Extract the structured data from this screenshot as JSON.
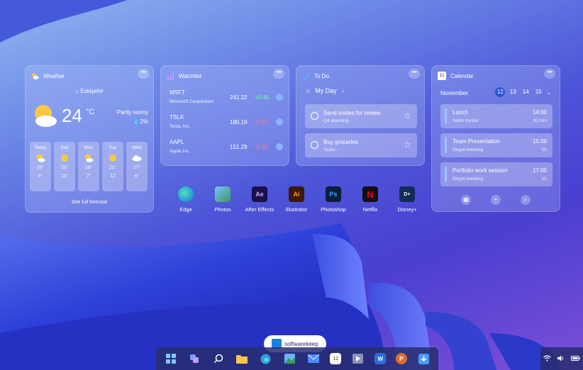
{
  "weather": {
    "title": "Weather",
    "more": "•••",
    "location": "Eskişehir",
    "temp": "24",
    "unit": "°C",
    "condition": "Partly sunny",
    "precip": "2%",
    "days": [
      {
        "name": "Today",
        "hi": "25°",
        "lo": "9°",
        "icon": "partly-sunny"
      },
      {
        "name": "Sun",
        "hi": "22°",
        "lo": "11°",
        "icon": "sunny"
      },
      {
        "name": "Mon",
        "hi": "18°",
        "lo": "7°",
        "icon": "partly-sunny"
      },
      {
        "name": "Tue",
        "hi": "21°",
        "lo": "12",
        "icon": "sunny"
      },
      {
        "name": "Wed",
        "hi": "17°",
        "lo": "6°",
        "icon": "cloudy"
      }
    ],
    "forecast_link": "See full forecast"
  },
  "watchlist": {
    "title": "Watchlist",
    "more": "•••",
    "stocks": [
      {
        "symbol": "MSFT",
        "name": "Microsoft Corporation",
        "price": "241.22",
        "change": "+0.46",
        "direction": "up"
      },
      {
        "symbol": "TSLA",
        "name": "Tesla, Inc.",
        "price": "180.19",
        "change": "-1.63",
        "direction": "down"
      },
      {
        "symbol": "AAPL",
        "name": "Apple Inc.",
        "price": "151.29",
        "change": "-0.38",
        "direction": "down"
      }
    ]
  },
  "todo": {
    "title": "To Do",
    "more": "•••",
    "list_name": "My Day",
    "tasks": [
      {
        "title": "Send invites for review",
        "list": "Q4 planning"
      },
      {
        "title": "Buy groceries",
        "list": "Tasks"
      }
    ]
  },
  "calendar": {
    "title": "Calendar",
    "icon_day": "12",
    "more": "•••",
    "month": "November",
    "days": [
      "12",
      "13",
      "14",
      "15"
    ],
    "selected_day": "12",
    "events": [
      {
        "title": "Lunch",
        "subtitle": "Selim Kestel",
        "time": "14:00",
        "duration": "30 min"
      },
      {
        "title": "Team Presentation",
        "subtitle": "Skype meeting",
        "time": "15:00",
        "duration": "1h"
      },
      {
        "title": "Portfolio work session",
        "subtitle": "Skype meeting",
        "time": "17:00",
        "duration": "1h"
      }
    ]
  },
  "apps": [
    {
      "label": "Edge",
      "icon": "edge-icon",
      "bg": "#0f7ad8",
      "glyph": "e"
    },
    {
      "label": "Photos",
      "icon": "photos-icon",
      "bg": "#3a9a5a",
      "glyph": ""
    },
    {
      "label": "After Effects",
      "icon": "after-effects-icon",
      "bg": "#1a0f4a",
      "glyph": "Ae"
    },
    {
      "label": "Illustrator",
      "icon": "illustrator-icon",
      "bg": "#3a1a08",
      "glyph": "Ai"
    },
    {
      "label": "Photoshop",
      "icon": "photoshop-icon",
      "bg": "#0a1e3a",
      "glyph": "Ps"
    },
    {
      "label": "Netflix",
      "icon": "netflix-icon",
      "bg": "#111111",
      "glyph": "N"
    },
    {
      "label": "Disney+",
      "icon": "disney-plus-icon",
      "bg": "#112c5a",
      "glyph": "D+"
    }
  ],
  "watermark": {
    "text": "softwarekeep"
  },
  "taskbar": {
    "items": [
      {
        "name": "start-icon",
        "glyph": "⊞",
        "color": "#7ec8ff"
      },
      {
        "name": "widgets-icon",
        "glyph": "▣",
        "color": "#9ab0ff"
      },
      {
        "name": "search-icon",
        "glyph": "⌕",
        "color": "#ffffff"
      },
      {
        "name": "file-explorer-icon",
        "glyph": "▬",
        "color": "#f5c84a"
      },
      {
        "name": "edge-taskbar-icon",
        "glyph": "e",
        "color": "#3bb0f0"
      },
      {
        "name": "photos-taskbar-icon",
        "glyph": "▲",
        "color": "#6bd08a"
      },
      {
        "name": "mail-icon",
        "glyph": "✉",
        "color": "#5aa0ff"
      },
      {
        "name": "calendar-taskbar-icon",
        "glyph": "12",
        "color": "#ffffff"
      },
      {
        "name": "media-icon",
        "glyph": "▶",
        "color": "#c0c8e8"
      },
      {
        "name": "word-icon",
        "glyph": "W",
        "color": "#2b6fd6"
      },
      {
        "name": "powerpoint-icon",
        "glyph": "P",
        "color": "#e06a2e"
      },
      {
        "name": "download-icon",
        "glyph": "⬇",
        "color": "#5aa8ff"
      }
    ]
  },
  "tray": {
    "wifi": "wifi-icon",
    "volume": "volume-icon",
    "battery": "battery-icon"
  },
  "colors": {
    "accent": "#2a54d6",
    "stock_up": "#6ef0b6",
    "stock_down": "#ff7a92"
  }
}
